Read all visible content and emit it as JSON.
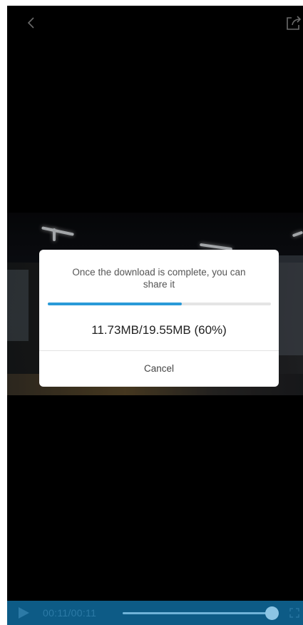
{
  "top_bar": {
    "back_icon": "chevron-left-icon",
    "share_icon": "share-icon"
  },
  "download_dialog": {
    "message": "Once the download is complete, you can share it",
    "progress_fraction": 0.6,
    "progress_text": "11.73MB/19.55MB (60%)",
    "cancel_label": "Cancel",
    "accent_color": "#2a9ad8"
  },
  "player_controls": {
    "play_icon": "play-icon",
    "time": "00:11/00:11",
    "seek_fraction": 1.0,
    "fullscreen_icon": "fullscreen-icon",
    "bar_color": "#0d5b86"
  }
}
